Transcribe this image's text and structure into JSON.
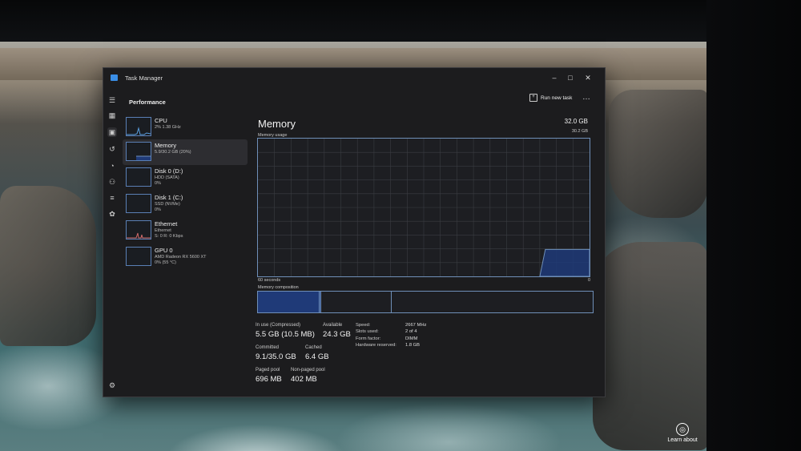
{
  "app": {
    "title": "Task Manager",
    "section": "Performance",
    "run_new_task": "Run new task",
    "more": "…",
    "window_buttons": [
      "–",
      "□",
      "✕"
    ]
  },
  "devices": [
    {
      "name": "CPU",
      "sub": "2% 1.38 GHz",
      "sub2": "",
      "selected": false
    },
    {
      "name": "Memory",
      "sub": "5.9/30.2 GB (20%)",
      "sub2": "",
      "selected": true
    },
    {
      "name": "Disk 0 (D:)",
      "sub": "HDD (SATA)",
      "sub2": "0%",
      "selected": false
    },
    {
      "name": "Disk 1 (C:)",
      "sub": "SSD (NVMe)",
      "sub2": "0%",
      "selected": false
    },
    {
      "name": "Ethernet",
      "sub": "Ethernet",
      "sub2": "S: 0 R: 0 Kbps",
      "selected": false
    },
    {
      "name": "GPU 0",
      "sub": "AMD Radeon RX 5600 XT",
      "sub2": "0% (55 °C)",
      "selected": false
    }
  ],
  "memory": {
    "title": "Memory",
    "total": "32.0 GB",
    "usage_label": "Memory usage",
    "usage_max": "30.2 GB",
    "axis_left": "60 seconds",
    "axis_right": "0",
    "composition_label": "Memory composition",
    "stats": {
      "in_use_label": "In use (Compressed)",
      "in_use": "5.5 GB (10.5 MB)",
      "available_label": "Available",
      "available": "24.3 GB",
      "committed_label": "Committed",
      "committed": "9.1/35.0 GB",
      "cached_label": "Cached",
      "cached": "6.4 GB",
      "paged_label": "Paged pool",
      "paged": "696 MB",
      "nonpaged_label": "Non-paged pool",
      "nonpaged": "402 MB"
    },
    "specs": [
      {
        "k": "Speed:",
        "v": "2667 MHz"
      },
      {
        "k": "Slots used:",
        "v": "2 of 4"
      },
      {
        "k": "Form factor:",
        "v": "DIMM"
      },
      {
        "k": "Hardware reserved:",
        "v": "1.8 GB"
      }
    ]
  },
  "desktop": {
    "learn_about": "Learn about"
  },
  "chart_data": {
    "type": "area",
    "title": "Memory usage",
    "xlabel": "",
    "ylabel": "",
    "x_range_seconds": [
      60,
      0
    ],
    "ylim_gb": [
      0,
      30.2
    ],
    "series": [
      {
        "values_gb_over_time": [
          0,
          0,
          0,
          0,
          0,
          0,
          0,
          0,
          0,
          0,
          0,
          0,
          0,
          0,
          0,
          0,
          0,
          0,
          0,
          0,
          0,
          0,
          0,
          0,
          0,
          0,
          0,
          0,
          0,
          0,
          0,
          0,
          0,
          0,
          0,
          0,
          0,
          0,
          0,
          0,
          0,
          0,
          0,
          0,
          0,
          0,
          0,
          0,
          0,
          0,
          0,
          0,
          5.9,
          5.9,
          5.9,
          5.9,
          5.9,
          5.9,
          5.9,
          5.9,
          5.9
        ]
      }
    ],
    "composition_gb": {
      "in_use": 5.5,
      "modified": 0.1,
      "standby": 6.4,
      "free": 18.2
    },
    "colors": {
      "fill": "#1f3a78",
      "line": "#6f8fb8",
      "grid": "#3a3c42"
    }
  }
}
